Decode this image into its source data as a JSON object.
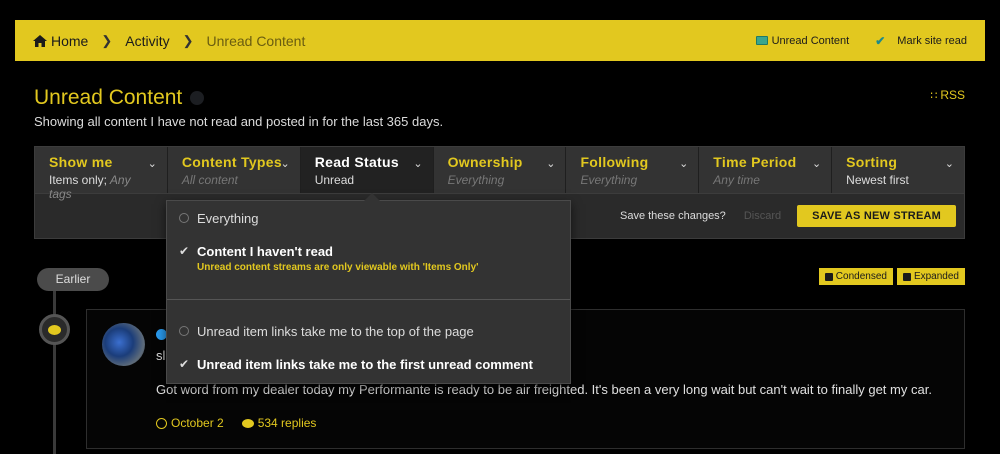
{
  "breadcrumb": {
    "home": "Home",
    "activity": "Activity",
    "current": "Unread Content"
  },
  "top_actions": {
    "unread": "Unread Content",
    "mark_read": "Mark site read"
  },
  "page": {
    "title": "Unread Content",
    "subtitle": "Showing all content I have not read and posted in for the last 365 days.",
    "rss": "RSS"
  },
  "filters": [
    {
      "label": "Show me",
      "value": "Items only;",
      "value_muted": " Any tags"
    },
    {
      "label": "Content Types",
      "value": "All content"
    },
    {
      "label": "Read Status",
      "value": "Unread"
    },
    {
      "label": "Ownership",
      "value": "Everything"
    },
    {
      "label": "Following",
      "value": "Everything"
    },
    {
      "label": "Time Period",
      "value": "Any time"
    },
    {
      "label": "Sorting",
      "value": "Newest first"
    }
  ],
  "save": {
    "question": "Save these changes?",
    "discard": "Discard",
    "button": "SAVE AS NEW STREAM"
  },
  "timeline": {
    "earlier": "Earlier"
  },
  "view_toggle": {
    "condensed": "Condensed",
    "expanded": "Expanded"
  },
  "menu": {
    "everything": "Everything",
    "not_read": "Content I haven't read",
    "not_read_note": "Unread content streams are only viewable with 'Items Only'",
    "link_top": "Unread item links take me to the top of the page",
    "link_first": "Unread item links take me to the first unread comment"
  },
  "post": {
    "title_partial": "sl",
    "body": "Got word from my dealer today my Performante is ready to be air freighted. It's been a very long wait but can't wait to finally get my car.",
    "date": "October 2",
    "replies": "534 replies"
  },
  "colors": {
    "accent": "#e2c81f",
    "background": "#000000",
    "panel": "#333333"
  }
}
